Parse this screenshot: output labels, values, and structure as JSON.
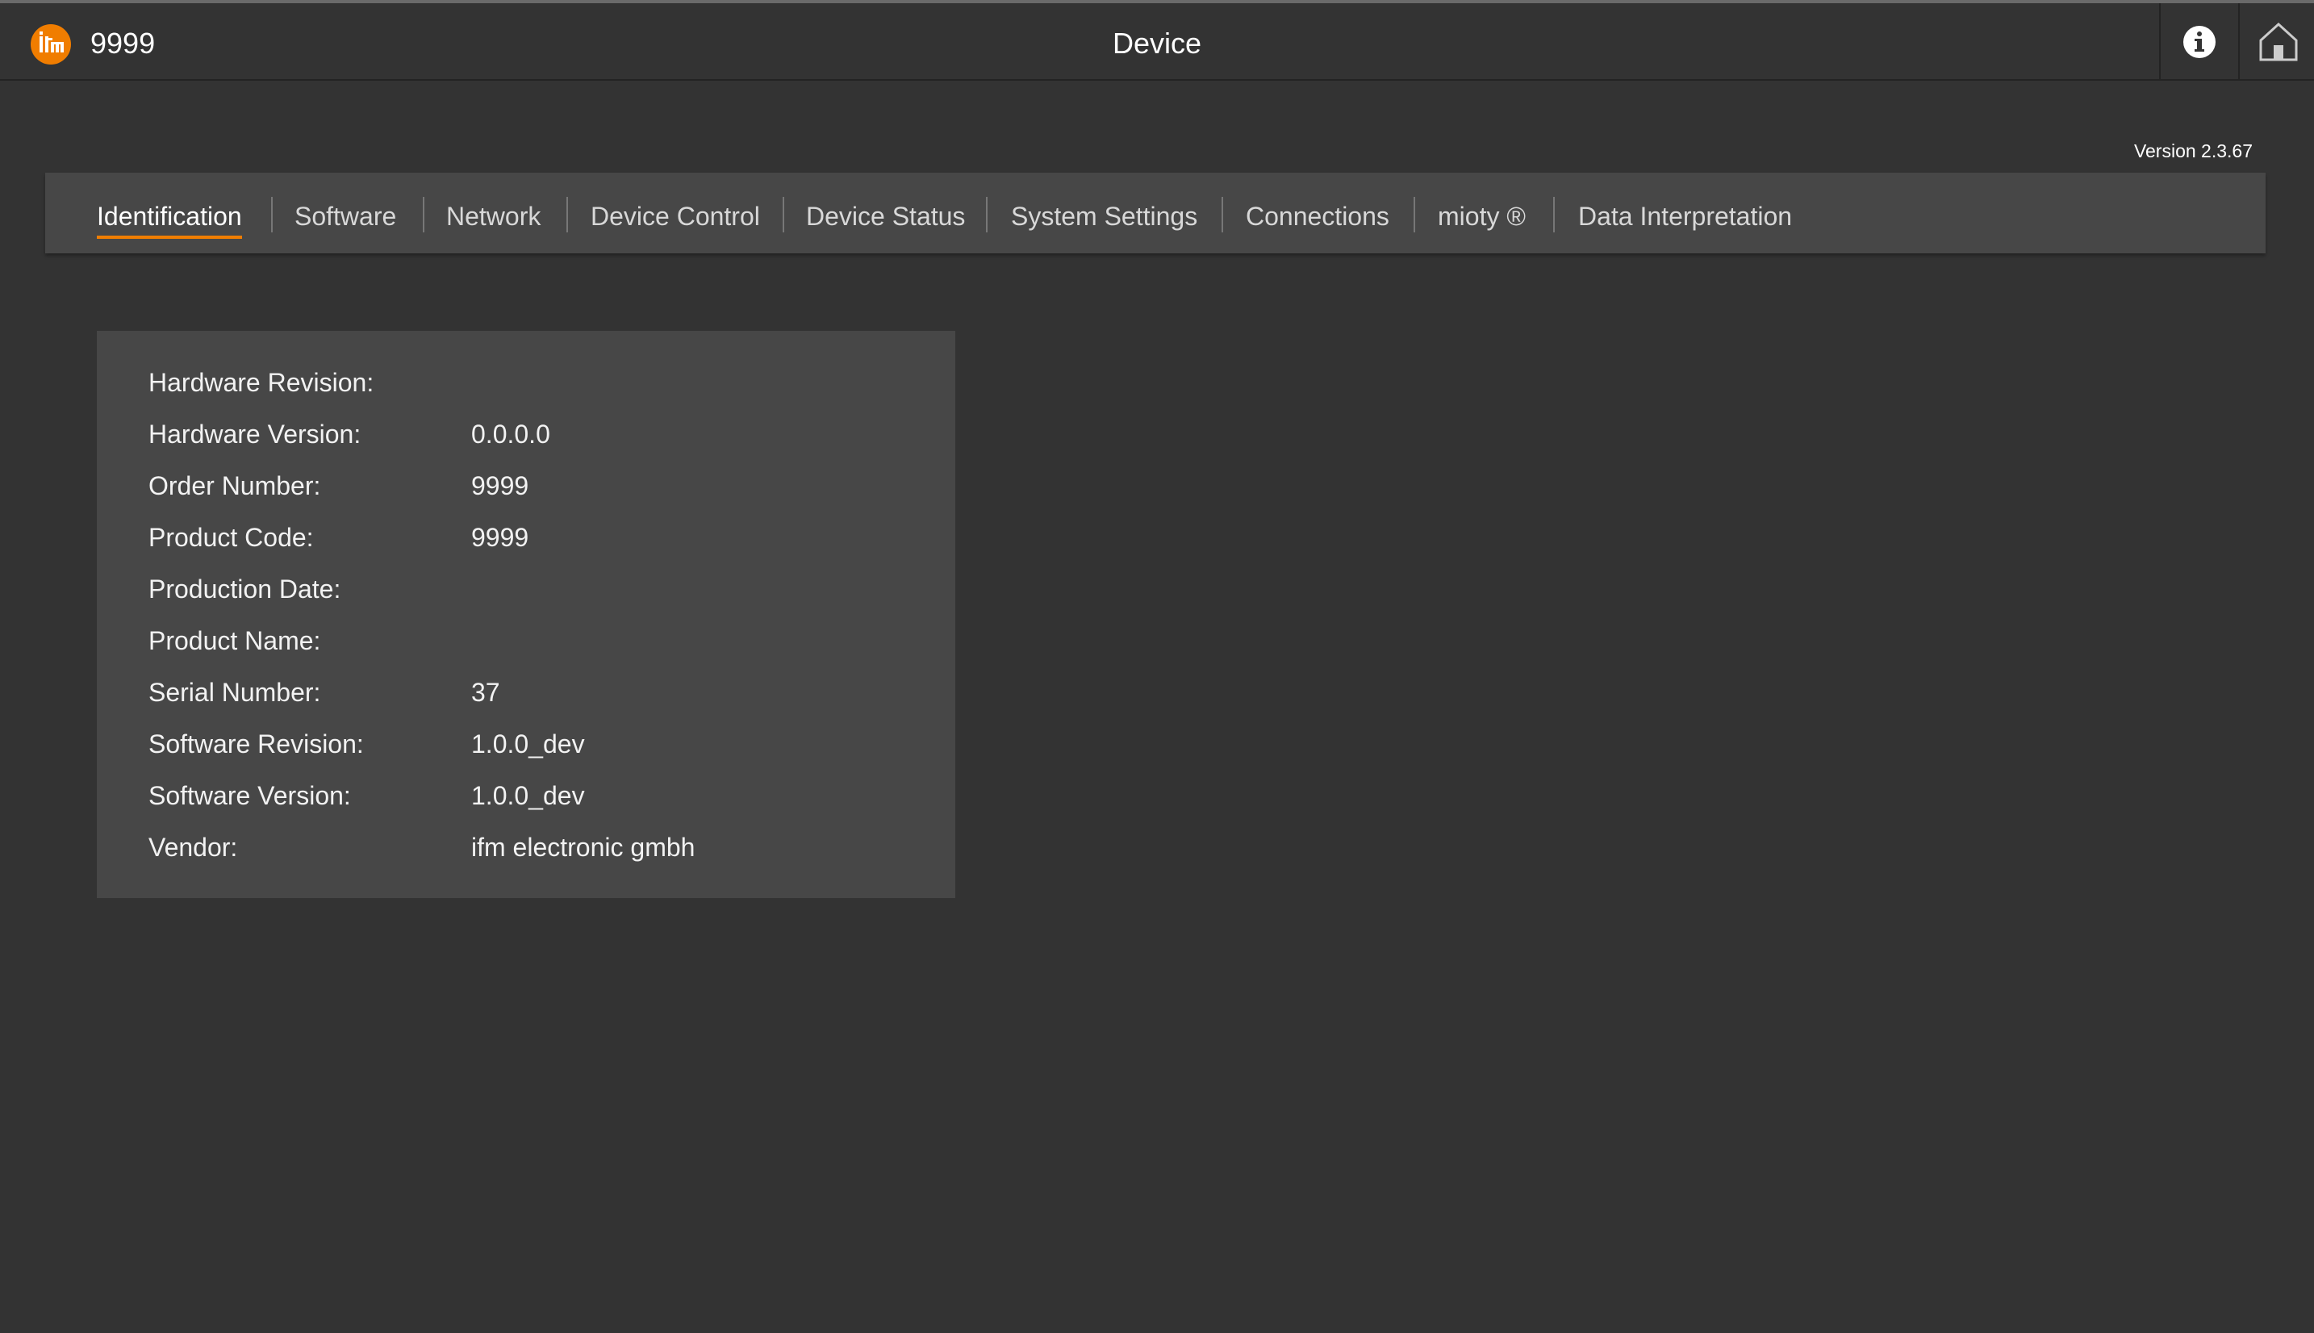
{
  "header": {
    "logo_icon": "ifm-logo-icon",
    "device_id": "9999",
    "title": "Device",
    "info_icon": "info-icon",
    "home_icon": "home-icon",
    "accent_color": "#f07d00"
  },
  "version": "Version 2.3.67",
  "tabs": [
    {
      "label": "Identification",
      "active": true
    },
    {
      "label": "Software",
      "active": false
    },
    {
      "label": "Network",
      "active": false
    },
    {
      "label": "Device Control",
      "active": false
    },
    {
      "label": "Device Status",
      "active": false
    },
    {
      "label": "System Settings",
      "active": false
    },
    {
      "label": "Connections",
      "active": false
    },
    {
      "label": "mioty ®",
      "active": false
    },
    {
      "label": "Data Interpretation",
      "active": false
    }
  ],
  "identification": [
    {
      "label": "Hardware Revision:",
      "value": ""
    },
    {
      "label": "Hardware Version:",
      "value": "0.0.0.0"
    },
    {
      "label": "Order Number:",
      "value": "9999"
    },
    {
      "label": "Product Code:",
      "value": "9999"
    },
    {
      "label": "Production Date:",
      "value": ""
    },
    {
      "label": "Product Name:",
      "value": ""
    },
    {
      "label": "Serial Number:",
      "value": "37"
    },
    {
      "label": "Software Revision:",
      "value": "1.0.0_dev"
    },
    {
      "label": "Software Version:",
      "value": "1.0.0_dev"
    },
    {
      "label": "Vendor:",
      "value": "ifm electronic gmbh"
    }
  ]
}
